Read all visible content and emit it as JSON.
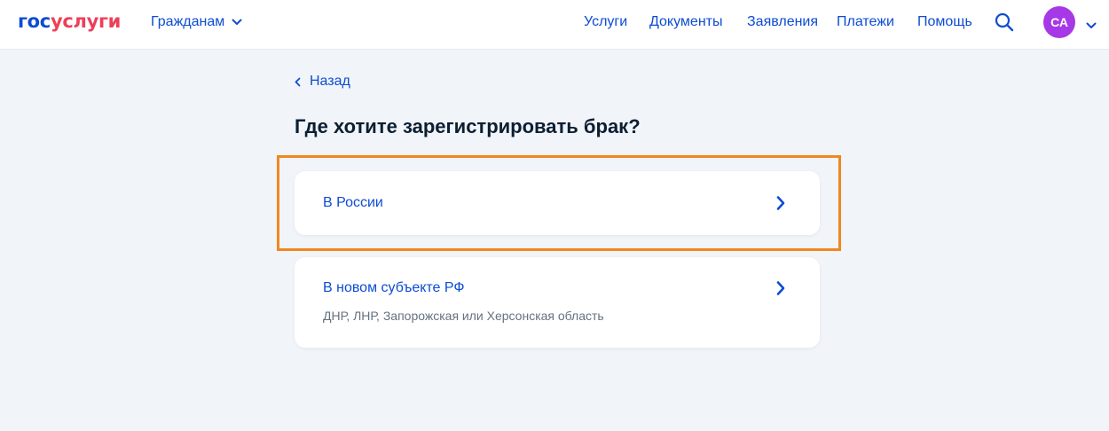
{
  "header": {
    "logo_part1": "гос",
    "logo_part2": "услуги",
    "audience_label": "Гражданам",
    "nav": [
      "Услуги",
      "Документы",
      "Заявления",
      "Платежи",
      "Помощь"
    ],
    "avatar_initials": "СА",
    "icons": {
      "audience": "chevron-down-icon",
      "search": "search-icon",
      "profile": "chevron-down-icon"
    }
  },
  "back": {
    "label": "Назад",
    "icon": "chevron-left-icon"
  },
  "page": {
    "title": "Где хотите зарегистрировать брак?"
  },
  "options": [
    {
      "title": "В России",
      "icon": "chevron-right-icon"
    },
    {
      "title": "В новом субъекте РФ",
      "subtitle": "ДНР, ЛНР, Запорожская или Херсонская область",
      "icon": "chevron-right-icon"
    }
  ],
  "colors": {
    "brand_blue": "#0d4cd3",
    "brand_red": "#ee3f58",
    "avatar": "#a638e7",
    "highlight": "#f0871f",
    "background": "#f1f4f8"
  }
}
